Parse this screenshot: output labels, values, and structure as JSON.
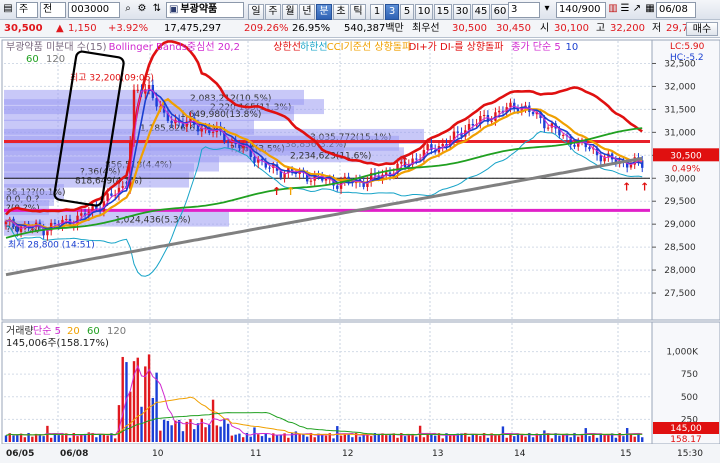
{
  "toolbar": {
    "market_select": "주",
    "period_select": "전",
    "code": "003000",
    "search_icon": "search-icon",
    "name": "부광약품",
    "period_buttons": [
      "일",
      "주",
      "월",
      "년",
      "분",
      "초",
      "틱"
    ],
    "active_period": "분",
    "interval_buttons": [
      "1",
      "3",
      "5",
      "10",
      "15",
      "30",
      "45",
      "60"
    ],
    "active_interval": "3",
    "interval_value": "3",
    "count": "140/900",
    "date": "06/08"
  },
  "quote": {
    "price": "30,500",
    "change": "1,150",
    "change_pct": "+3.92%",
    "volume": "17,475,297",
    "vol_ratio": "209.26%",
    "turnover_ratio": "26.95%",
    "amount": "540,387백만",
    "best_label": "최우선",
    "best_ask": "30,500",
    "best_bid": "30,450",
    "open_label": "시",
    "open": "30,100",
    "high_label": "고",
    "high": "32,200",
    "low_label": "저",
    "low": "29,750",
    "sell_button": "매수"
  },
  "price_panel": {
    "legend": [
      {
        "text": "부광약품 미분대 수(15)",
        "color": "#7a6a80"
      },
      {
        "text": "Bollinger Bands중심선 20,2",
        "color": "#d02ad0"
      },
      {
        "text": "상한선",
        "color": "#e01010"
      },
      {
        "text": "하한선",
        "color": "#18a4c8"
      },
      {
        "text": "CCI기준선 상향돌파",
        "color": "#f0a000"
      },
      {
        "text": "DI+가 DI-를 상향돌파",
        "color": "#e01010"
      },
      {
        "text": "종가 단순 5",
        "color": "#d02ad0"
      },
      {
        "text": "10",
        "color": "#1a3fd0"
      }
    ],
    "legend2": [
      {
        "text": "60",
        "color": "#20a020"
      },
      {
        "text": "120",
        "color": "#777777"
      }
    ],
    "lc_label": "LC:5.90",
    "hc_label": "HC:-5.2",
    "price_tag": "30,500",
    "pct_tag": "0.49%",
    "high_annotation": "최고 32,200(09:06)",
    "low_annotation": "최저 28,800 (14:51)",
    "colors": {
      "up": "#e0181e",
      "down": "#1b3fd6",
      "grid": "#c9d3e2",
      "panel_bg": "#ffffff"
    }
  },
  "volume_panel": {
    "legend": [
      {
        "text": "거래량",
        "color": "#333333"
      },
      {
        "text": "단순 5",
        "color": "#d02ad0"
      },
      {
        "text": "20",
        "color": "#f0a000"
      },
      {
        "text": "60",
        "color": "#20a020"
      },
      {
        "text": "120",
        "color": "#777777"
      }
    ],
    "max_label": "145,006주(158.17%)",
    "y_ticks": [
      "1,000K",
      "750",
      "500",
      "250"
    ],
    "last_vol_tag": "145,00",
    "vol_pct_tag": "158.17",
    "x_labels": [
      "06/05",
      "06/08",
      "10",
      "11",
      "12",
      "13",
      "14",
      "15"
    ],
    "time_label": "15:30"
  },
  "chart_data": [
    {
      "type": "candlestick",
      "title": "부광약품",
      "y_ticks": [
        32500,
        32000,
        31500,
        31000,
        30500,
        30000,
        29500,
        29000,
        28500,
        28000,
        27500
      ],
      "ylim": [
        27000,
        32750
      ],
      "high": 32200,
      "low": 28800,
      "last": 30500,
      "horizontal_lines": [
        {
          "value": 30800,
          "color": "#e8202a",
          "label": "red-line"
        },
        {
          "value": 29300,
          "color": "#e020c8",
          "label": "magenta-line"
        },
        {
          "value": 30000,
          "color": "#111111",
          "label": "black-line"
        }
      ],
      "volume_profile": [
        {
          "value": 31750,
          "label": "2,083,212(10.5%)"
        },
        {
          "value": 31550,
          "label": "2,220,165(11.3%)"
        },
        {
          "value": 31400,
          "label": "1,649,980(13.8%)"
        },
        {
          "value": 31100,
          "label": "1,185,826(6.2%)"
        },
        {
          "value": 30900,
          "label": "3,035,772(15.1%)"
        },
        {
          "value": 30750,
          "label": "38,856(3.2%)"
        },
        {
          "value": 30650,
          "label": "?,264(3.5%)"
        },
        {
          "value": 30500,
          "label": "2,234,623(11.6%)"
        },
        {
          "value": 30300,
          "label": "856,518(4.4%)"
        },
        {
          "value": 30150,
          "label": "?,36(4%)"
        },
        {
          "value": 29950,
          "label": "818,649(4.3%)"
        },
        {
          "value": 29700,
          "label": "36,1??(0.1%)"
        },
        {
          "value": 29550,
          "label": "0.0, 0.?"
        },
        {
          "value": 29350,
          "label": "?(0.?%)"
        },
        {
          "value": 29100,
          "label": "1,024,436(5.3%)"
        },
        {
          "value": 28900,
          "label": "?(0.?%)"
        }
      ]
    },
    {
      "type": "bar",
      "title": "거래량",
      "y_ticks": [
        1000000,
        750000,
        500000,
        250000
      ],
      "last": 145006
    }
  ]
}
